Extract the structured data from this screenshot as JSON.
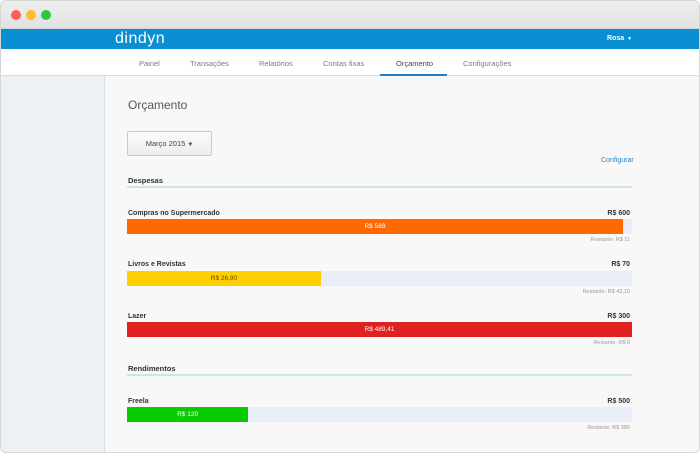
{
  "app": {
    "brand": "dindyn",
    "user": "Rosa",
    "user_caret": "▼"
  },
  "nav": {
    "tabs": [
      {
        "label": "Painel",
        "active": false
      },
      {
        "label": "Transações",
        "active": false
      },
      {
        "label": "Relatórios",
        "active": false
      },
      {
        "label": "Contas fixas",
        "active": false
      },
      {
        "label": "Orçamento",
        "active": true
      },
      {
        "label": "Configurações",
        "active": false
      }
    ]
  },
  "page": {
    "title": "Orçamento",
    "month_button": "Março 2015",
    "month_caret": "▼",
    "configure_link": "Configurar"
  },
  "sections": {
    "expenses": {
      "title": "Despesas",
      "items": [
        {
          "name": "Compras no Supermercado",
          "total": "R$ 600",
          "spent": "R$ 589",
          "remaining": "Restante: R$ 11",
          "fill_fraction": 0.982,
          "color": "#ff6a00"
        },
        {
          "name": "Livros e Revistas",
          "total": "R$ 70",
          "spent": "R$ 26,90",
          "remaining": "Restante: R$ 43,10",
          "fill_fraction": 0.384,
          "color": "#ffcf00"
        },
        {
          "name": "Lazer",
          "total": "R$ 300",
          "spent": "R$ 489,41",
          "remaining": "Restante: R$ 0",
          "fill_fraction": 1.0,
          "color": "#df2121"
        }
      ]
    },
    "income": {
      "title": "Rendimentos",
      "items": [
        {
          "name": "Freela",
          "total": "R$ 500",
          "spent": "R$ 120",
          "remaining": "Restante: R$ 380",
          "fill_fraction": 0.24,
          "color": "#0acb00"
        }
      ]
    }
  }
}
